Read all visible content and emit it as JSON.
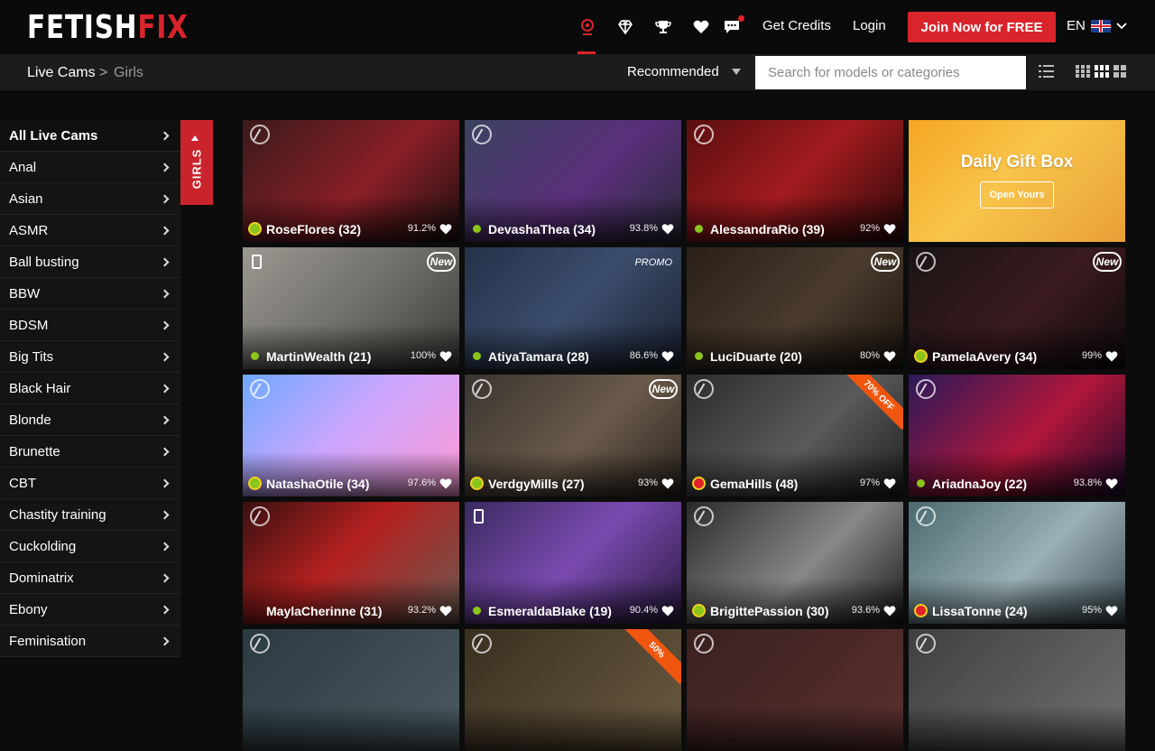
{
  "header": {
    "logo_white": "FETISH",
    "logo_red": "FIX",
    "nav_icons": [
      "live-cams-icon",
      "diamond-icon",
      "trophy-icon",
      "heart-icon",
      "chat-icon"
    ],
    "get_credits": "Get Credits",
    "login": "Login",
    "join": "Join Now for FREE",
    "language": "EN"
  },
  "subbar": {
    "crumb_root": "Live Cams",
    "crumb_sep": ">",
    "crumb_current": "Girls",
    "sort_label": "Recommended",
    "search_placeholder": "Search for models or categories"
  },
  "sidebar": {
    "tab_label": "GIRLS",
    "items": [
      {
        "label": "All Live Cams"
      },
      {
        "label": "Anal"
      },
      {
        "label": "Asian"
      },
      {
        "label": "ASMR"
      },
      {
        "label": "Ball busting"
      },
      {
        "label": "BBW"
      },
      {
        "label": "BDSM"
      },
      {
        "label": "Big Tits"
      },
      {
        "label": "Black Hair"
      },
      {
        "label": "Blonde"
      },
      {
        "label": "Brunette"
      },
      {
        "label": "CBT"
      },
      {
        "label": "Chastity training"
      },
      {
        "label": "Cuckolding"
      },
      {
        "label": "Dominatrix"
      },
      {
        "label": "Ebony"
      },
      {
        "label": "Feminisation"
      }
    ]
  },
  "gift_box": {
    "title": "Daily Gift Box",
    "button": "Open Yours"
  },
  "models": [
    {
      "name": "RoseFlores (32)",
      "rating": "91.2%",
      "badge": "hd",
      "status": "ring"
    },
    {
      "name": "DevashaThea (34)",
      "rating": "93.8%",
      "badge": "hd",
      "status": "online"
    },
    {
      "name": "AlessandraRio (39)",
      "rating": "92%",
      "badge": "hd",
      "status": "online"
    },
    {
      "name": "MartinWealth (21)",
      "rating": "100%",
      "badge": "mobile",
      "tag": "New",
      "status": "online"
    },
    {
      "name": "AtiyaTamara (28)",
      "rating": "86.6%",
      "badge": "none",
      "tag": "PROMO",
      "status": "online"
    },
    {
      "name": "LuciDuarte (20)",
      "rating": "80%",
      "badge": "none",
      "tag": "New",
      "status": "online"
    },
    {
      "name": "PamelaAvery (34)",
      "rating": "99%",
      "badge": "hd",
      "tag": "New",
      "status": "ring"
    },
    {
      "name": "NatashaOtile (34)",
      "rating": "97.6%",
      "badge": "hd",
      "status": "ring"
    },
    {
      "name": "VerdgyMills (27)",
      "rating": "93%",
      "badge": "hd",
      "tag": "New",
      "status": "ring"
    },
    {
      "name": "GemaHills (48)",
      "rating": "97%",
      "badge": "hd",
      "tag": "70% OFF",
      "status": "red"
    },
    {
      "name": "AriadnaJoy (22)",
      "rating": "93.8%",
      "badge": "hd",
      "status": "online"
    },
    {
      "name": "MaylaCherinne (31)",
      "rating": "93.2%",
      "badge": "hd",
      "status": "none"
    },
    {
      "name": "EsmeraldaBlake (19)",
      "rating": "90.4%",
      "badge": "mobile",
      "status": "online"
    },
    {
      "name": "BrigittePassion (30)",
      "rating": "93.6%",
      "badge": "hd",
      "status": "ring"
    },
    {
      "name": "LissaTonne (24)",
      "rating": "95%",
      "badge": "hd",
      "status": "red"
    },
    {
      "name": "",
      "rating": "",
      "badge": "hd",
      "status": "none"
    },
    {
      "name": "",
      "rating": "",
      "badge": "hd",
      "tag": "50%",
      "status": "none"
    },
    {
      "name": "",
      "rating": "",
      "badge": "hd",
      "status": "none"
    },
    {
      "name": "",
      "rating": "",
      "badge": "hd",
      "status": "none"
    }
  ],
  "colors": {
    "accent": "#d9242c",
    "online": "#8bc41a",
    "gift": "#f6a623"
  }
}
